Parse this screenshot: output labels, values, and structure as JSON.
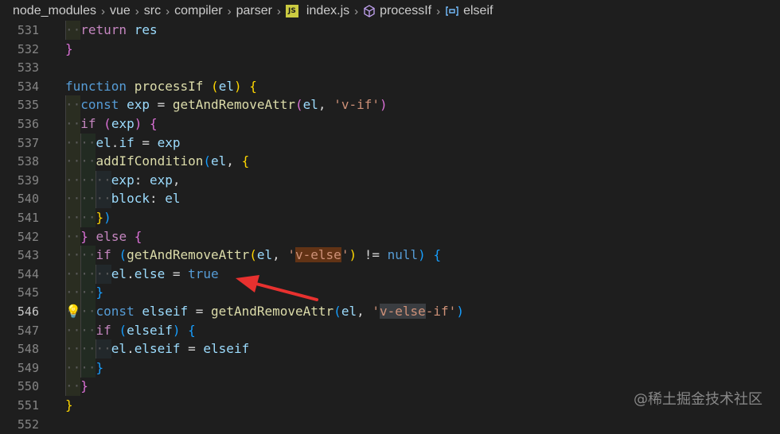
{
  "breadcrumb": {
    "items": [
      {
        "label": "node_modules",
        "icon": ""
      },
      {
        "label": "vue",
        "icon": ""
      },
      {
        "label": "src",
        "icon": ""
      },
      {
        "label": "compiler",
        "icon": ""
      },
      {
        "label": "parser",
        "icon": ""
      },
      {
        "label": "index.js",
        "icon": "js-file-icon",
        "icon_text": "JS"
      },
      {
        "label": "processIf",
        "icon": "symbol-method-icon"
      },
      {
        "label": "elseif",
        "icon": "symbol-variable-icon"
      }
    ],
    "separator": "›"
  },
  "editor": {
    "active_line": "546",
    "lines": [
      {
        "n": "531",
        "indent": 1,
        "tokens": [
          [
            "ctl",
            "return"
          ],
          [
            "p",
            " "
          ],
          [
            "var",
            "res"
          ]
        ]
      },
      {
        "n": "532",
        "indent": 0,
        "tokens": [
          [
            "br2",
            "}"
          ]
        ]
      },
      {
        "n": "533",
        "indent": 0,
        "tokens": []
      },
      {
        "n": "534",
        "indent": 0,
        "tokens": [
          [
            "kw",
            "function"
          ],
          [
            "p",
            " "
          ],
          [
            "fn",
            "processIf"
          ],
          [
            "p",
            " "
          ],
          [
            "br1",
            "("
          ],
          [
            "var",
            "el"
          ],
          [
            "br1",
            ")"
          ],
          [
            "p",
            " "
          ],
          [
            "br1",
            "{"
          ]
        ]
      },
      {
        "n": "535",
        "indent": 1,
        "tokens": [
          [
            "kw",
            "const"
          ],
          [
            "p",
            " "
          ],
          [
            "var",
            "exp"
          ],
          [
            "p",
            " = "
          ],
          [
            "fn",
            "getAndRemoveAttr"
          ],
          [
            "br2",
            "("
          ],
          [
            "var",
            "el"
          ],
          [
            "p",
            ", "
          ],
          [
            "str",
            "'v-if'"
          ],
          [
            "br2",
            ")"
          ]
        ]
      },
      {
        "n": "536",
        "indent": 1,
        "tokens": [
          [
            "ctl",
            "if"
          ],
          [
            "p",
            " "
          ],
          [
            "br2",
            "("
          ],
          [
            "var",
            "exp"
          ],
          [
            "br2",
            ")"
          ],
          [
            "p",
            " "
          ],
          [
            "br2",
            "{"
          ]
        ]
      },
      {
        "n": "537",
        "indent": 2,
        "tokens": [
          [
            "var",
            "el"
          ],
          [
            "p",
            "."
          ],
          [
            "var",
            "if"
          ],
          [
            "p",
            " = "
          ],
          [
            "var",
            "exp"
          ]
        ]
      },
      {
        "n": "538",
        "indent": 2,
        "tokens": [
          [
            "fn",
            "addIfCondition"
          ],
          [
            "br3",
            "("
          ],
          [
            "var",
            "el"
          ],
          [
            "p",
            ", "
          ],
          [
            "br1",
            "{"
          ]
        ]
      },
      {
        "n": "539",
        "indent": 3,
        "tokens": [
          [
            "var",
            "exp"
          ],
          [
            "p",
            ": "
          ],
          [
            "var",
            "exp"
          ],
          [
            "p",
            ","
          ]
        ]
      },
      {
        "n": "540",
        "indent": 3,
        "tokens": [
          [
            "var",
            "block"
          ],
          [
            "p",
            ": "
          ],
          [
            "var",
            "el"
          ]
        ]
      },
      {
        "n": "541",
        "indent": 2,
        "tokens": [
          [
            "br1",
            "}"
          ],
          [
            "br3",
            ")"
          ]
        ]
      },
      {
        "n": "542",
        "indent": 1,
        "tokens": [
          [
            "br2",
            "}"
          ],
          [
            "p",
            " "
          ],
          [
            "ctl",
            "else"
          ],
          [
            "p",
            " "
          ],
          [
            "br2",
            "{"
          ]
        ]
      },
      {
        "n": "543",
        "indent": 2,
        "tokens": [
          [
            "ctl",
            "if"
          ],
          [
            "p",
            " "
          ],
          [
            "br3",
            "("
          ],
          [
            "fn",
            "getAndRemoveAttr"
          ],
          [
            "br1",
            "("
          ],
          [
            "var",
            "el"
          ],
          [
            "p",
            ", "
          ],
          [
            "str",
            "'"
          ],
          [
            "strhl",
            "v-else"
          ],
          [
            "str",
            "'"
          ],
          [
            "br1",
            ")"
          ],
          [
            "p",
            " != "
          ],
          [
            "kw",
            "null"
          ],
          [
            "br3",
            ")"
          ],
          [
            "p",
            " "
          ],
          [
            "br3",
            "{"
          ]
        ]
      },
      {
        "n": "544",
        "indent": 3,
        "tokens": [
          [
            "var",
            "el"
          ],
          [
            "p",
            "."
          ],
          [
            "var",
            "else"
          ],
          [
            "p",
            " = "
          ],
          [
            "kw",
            "true"
          ]
        ]
      },
      {
        "n": "545",
        "indent": 2,
        "tokens": [
          [
            "br3",
            "}"
          ]
        ]
      },
      {
        "n": "546",
        "indent": 2,
        "tokens": [
          [
            "kw",
            "const"
          ],
          [
            "p",
            " "
          ],
          [
            "var",
            "elseif"
          ],
          [
            "p",
            " = "
          ],
          [
            "fn",
            "getAndRemoveAttr"
          ],
          [
            "br3",
            "("
          ],
          [
            "var",
            "el"
          ],
          [
            "p",
            ", "
          ],
          [
            "str",
            "'"
          ],
          [
            "strhl2",
            "v-else"
          ],
          [
            "str",
            "-if'"
          ],
          [
            "br3",
            ")"
          ]
        ]
      },
      {
        "n": "547",
        "indent": 2,
        "tokens": [
          [
            "ctl",
            "if"
          ],
          [
            "p",
            " "
          ],
          [
            "br3",
            "("
          ],
          [
            "var",
            "elseif"
          ],
          [
            "br3",
            ")"
          ],
          [
            "p",
            " "
          ],
          [
            "br3",
            "{"
          ]
        ]
      },
      {
        "n": "548",
        "indent": 3,
        "tokens": [
          [
            "var",
            "el"
          ],
          [
            "p",
            "."
          ],
          [
            "var",
            "elseif"
          ],
          [
            "p",
            " = "
          ],
          [
            "var",
            "elseif"
          ]
        ]
      },
      {
        "n": "549",
        "indent": 2,
        "tokens": [
          [
            "br3",
            "}"
          ]
        ]
      },
      {
        "n": "550",
        "indent": 1,
        "tokens": [
          [
            "br2",
            "}"
          ]
        ]
      },
      {
        "n": "551",
        "indent": 0,
        "tokens": [
          [
            "br1",
            "}"
          ]
        ]
      },
      {
        "n": "552",
        "indent": 0,
        "tokens": []
      }
    ]
  },
  "lightbulb_icon": "lightbulb-icon",
  "annotation": {
    "icon": "red-arrow-annotation",
    "color": "#e8312f"
  },
  "watermark": "@稀土掘金技术社区",
  "colors": {
    "background": "#1e1e1e",
    "keyword": "#569cd6",
    "control": "#c586c0",
    "function": "#dcdcaa",
    "variable": "#9cdcfe",
    "string": "#ce9178"
  }
}
